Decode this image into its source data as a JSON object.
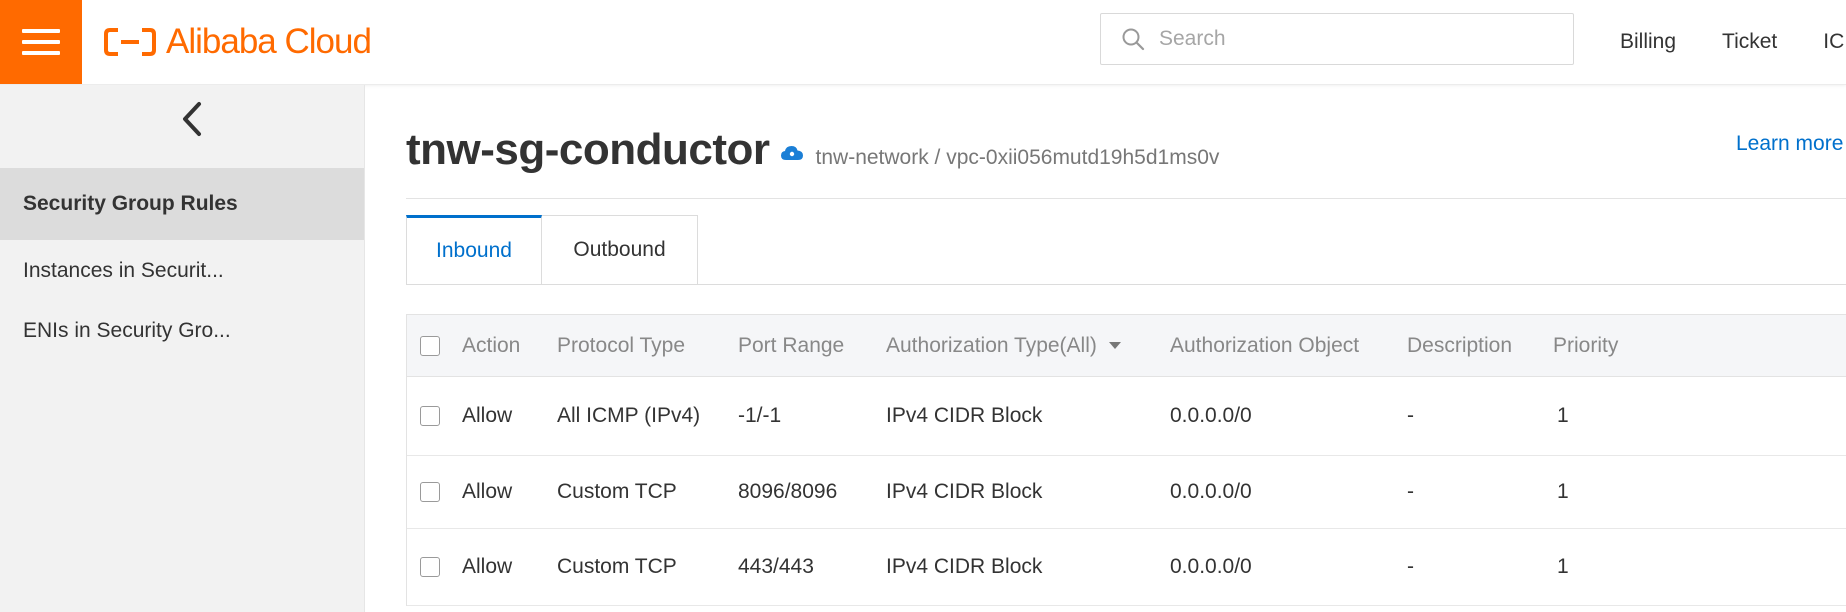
{
  "header": {
    "logo_text": "Alibaba Cloud",
    "search_placeholder": "Search",
    "nav": [
      "Billing",
      "Ticket",
      "IC"
    ]
  },
  "sidebar": {
    "items": [
      {
        "label": "Security Group Rules",
        "active": true
      },
      {
        "label": "Instances in Securit...",
        "active": false
      },
      {
        "label": "ENIs in Security Gro...",
        "active": false
      }
    ]
  },
  "page": {
    "title": "tnw-sg-conductor",
    "breadcrumb": "tnw-network / vpc-0xii056mutd19h5d1ms0v",
    "learn_more": "Learn more"
  },
  "tabs": [
    {
      "label": "Inbound",
      "active": true
    },
    {
      "label": "Outbound",
      "active": false
    }
  ],
  "table": {
    "headers": {
      "action": "Action",
      "protocol": "Protocol Type",
      "port": "Port Range",
      "auth_type": "Authorization Type(All)",
      "auth_object": "Authorization Object",
      "description": "Description",
      "priority": "Priority"
    },
    "rows": [
      {
        "action": "Allow",
        "protocol": "All ICMP (IPv4)",
        "port": "-1/-1",
        "auth_type": "IPv4 CIDR Block",
        "auth_object": "0.0.0.0/0",
        "description": "-",
        "priority": "1"
      },
      {
        "action": "Allow",
        "protocol": "Custom TCP",
        "port": "8096/8096",
        "auth_type": "IPv4 CIDR Block",
        "auth_object": "0.0.0.0/0",
        "description": "-",
        "priority": "1"
      },
      {
        "action": "Allow",
        "protocol": "Custom TCP",
        "port": "443/443",
        "auth_type": "IPv4 CIDR Block",
        "auth_object": "0.0.0.0/0",
        "description": "-",
        "priority": "1"
      }
    ]
  },
  "colors": {
    "brand": "#ff6a00",
    "link": "#0070cc",
    "sidebar_bg": "#f2f2f2",
    "sidebar_active": "#dcdcdc"
  },
  "icons": {
    "menu": "hamburger-menu-icon",
    "logo": "alibaba-cloud-logo-icon",
    "search": "search-icon",
    "collapse": "chevron-left-icon",
    "vpc": "cloud-icon",
    "sort": "caret-down-icon"
  }
}
